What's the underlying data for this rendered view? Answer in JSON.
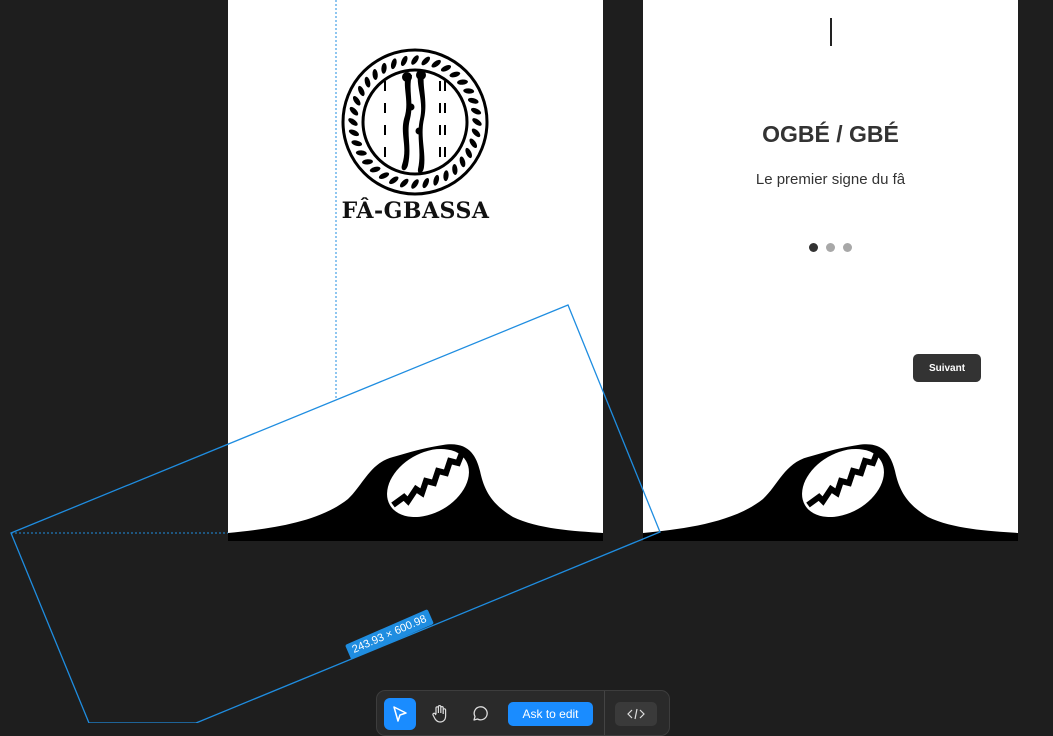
{
  "splash": {
    "brand_name": "FÂ-GBASSA"
  },
  "onboarding": {
    "title": "OGBÉ / GBÉ",
    "subtitle": "Le premier signe du fâ",
    "page_indicator": {
      "total": 3,
      "current": 1
    },
    "next_label": "Suivant"
  },
  "selection": {
    "dimensions_label": "243.93 × 600.98",
    "color": "#1f8de0"
  },
  "toolbar": {
    "tools": [
      "select-tool",
      "hand-tool",
      "comment-tool"
    ],
    "ask_label": "Ask to edit",
    "code_icon": "code-icon",
    "accent": "#1a8cff"
  },
  "colors": {
    "canvas": "#1e1e1e",
    "frame": "#ffffff",
    "text_dark": "#333333",
    "dot_inactive": "#a8a8a8"
  }
}
